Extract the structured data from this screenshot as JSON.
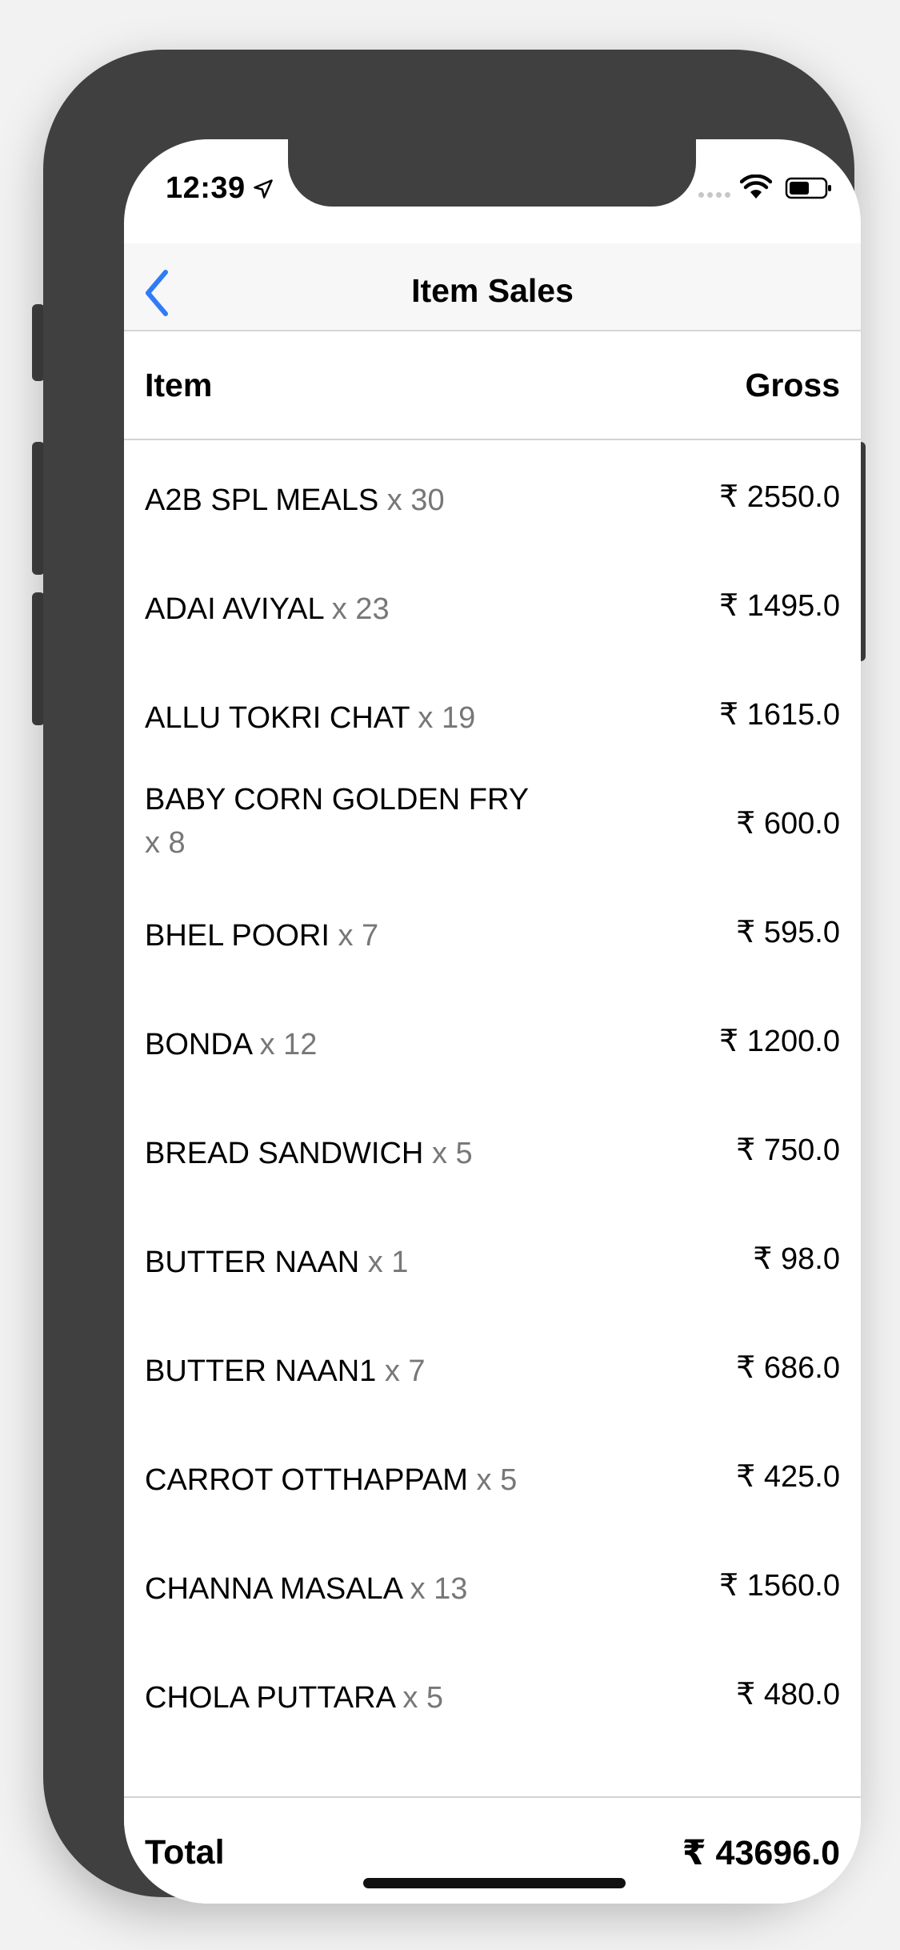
{
  "status_bar": {
    "time": "12:39"
  },
  "navbar": {
    "title": "Item Sales"
  },
  "table": {
    "columns": {
      "item": "Item",
      "gross": "Gross"
    },
    "rows": [
      {
        "name": "A2B SPL MEALS",
        "qty": "x 30",
        "gross": "₹ 2550.0"
      },
      {
        "name": "ADAI AVIYAL",
        "qty": "x 23",
        "gross": "₹ 1495.0"
      },
      {
        "name": "ALLU TOKRI CHAT",
        "qty": "x 19",
        "gross": "₹ 1615.0"
      },
      {
        "name": "BABY CORN GOLDEN FRY",
        "qty": "x 8",
        "gross": "₹ 600.0"
      },
      {
        "name": "BHEL POORI",
        "qty": "x 7",
        "gross": "₹ 595.0"
      },
      {
        "name": "BONDA",
        "qty": "x 12",
        "gross": "₹ 1200.0"
      },
      {
        "name": "BREAD SANDWICH",
        "qty": "x 5",
        "gross": "₹ 750.0"
      },
      {
        "name": "BUTTER NAAN",
        "qty": "x 1",
        "gross": "₹ 98.0"
      },
      {
        "name": "BUTTER NAAN1",
        "qty": "x 7",
        "gross": "₹ 686.0"
      },
      {
        "name": "CARROT OTTHAPPAM",
        "qty": "x 5",
        "gross": "₹ 425.0"
      },
      {
        "name": "CHANNA MASALA",
        "qty": "x 13",
        "gross": "₹ 1560.0"
      },
      {
        "name": "CHOLA PUTTARA",
        "qty": "x 5",
        "gross": "₹ 480.0"
      }
    ]
  },
  "total": {
    "label": "Total",
    "value": "₹ 43696.0"
  },
  "colors": {
    "accent": "#2f7cf6",
    "qty_gray": "#777777",
    "device_frame": "#404040"
  },
  "icons": {
    "back": "chevron-left-icon",
    "location": "location-arrow-icon",
    "wifi": "wifi-icon",
    "battery": "battery-icon"
  }
}
